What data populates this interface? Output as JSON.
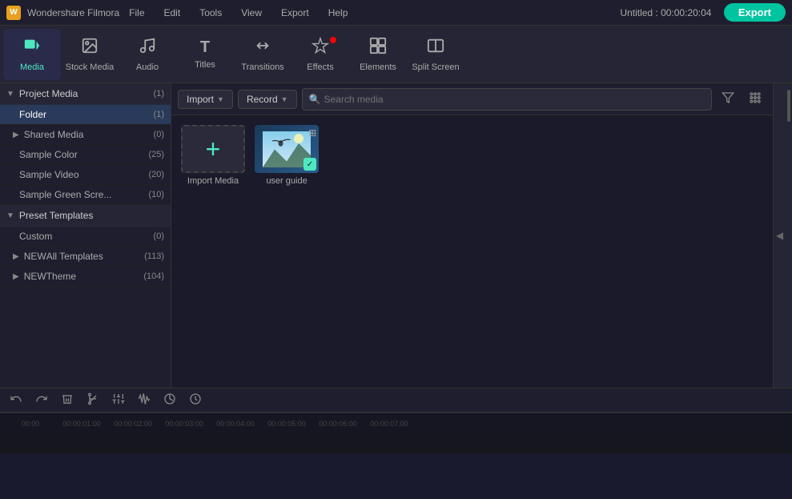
{
  "app": {
    "name": "Wondershare Filmora",
    "logo_letter": "W",
    "title": "Untitled : 00:00:20:04"
  },
  "menu": {
    "items": [
      "File",
      "Edit",
      "Tools",
      "View",
      "Export",
      "Help"
    ]
  },
  "toolbar": {
    "items": [
      {
        "id": "media",
        "label": "Media",
        "icon": "🎬",
        "active": true,
        "badge": false
      },
      {
        "id": "stock-media",
        "label": "Stock Media",
        "icon": "🖼",
        "active": false,
        "badge": false
      },
      {
        "id": "audio",
        "label": "Audio",
        "icon": "🎵",
        "active": false,
        "badge": false
      },
      {
        "id": "titles",
        "label": "Titles",
        "icon": "T",
        "active": false,
        "badge": false
      },
      {
        "id": "transitions",
        "label": "Transitions",
        "icon": "⇄",
        "active": false,
        "badge": false
      },
      {
        "id": "effects",
        "label": "Effects",
        "icon": "✦",
        "active": false,
        "badge": true
      },
      {
        "id": "elements",
        "label": "Elements",
        "icon": "◈",
        "active": false,
        "badge": false
      },
      {
        "id": "split-screen",
        "label": "Split Screen",
        "icon": "⊞",
        "active": false,
        "badge": false
      }
    ],
    "export_label": "Export"
  },
  "sidebar": {
    "project_media_label": "Project Media",
    "project_media_count": "(1)",
    "folder_label": "Folder",
    "folder_count": "(1)",
    "shared_media_label": "Shared Media",
    "shared_media_count": "(0)",
    "sample_color_label": "Sample Color",
    "sample_color_count": "(25)",
    "sample_video_label": "Sample Video",
    "sample_video_count": "(20)",
    "sample_green_label": "Sample Green Scre...",
    "sample_green_count": "(10)",
    "preset_templates_label": "Preset Templates",
    "custom_label": "Custom",
    "custom_count": "(0)",
    "all_templates_label": "All Templates",
    "all_templates_count": "(113)",
    "theme_label": "Theme",
    "theme_count": "(104)"
  },
  "content_toolbar": {
    "import_label": "Import",
    "record_label": "Record",
    "search_placeholder": "Search media"
  },
  "media_items": [
    {
      "id": "import",
      "label": "Import Media",
      "type": "import"
    },
    {
      "id": "user-guide",
      "label": "user guide",
      "type": "video"
    }
  ],
  "timeline": {
    "rulers": [
      "00:00",
      "00:00:01:00",
      "00:00:02:00",
      "00:00:03:00",
      "00:00:04:00",
      "00:00:05:00",
      "00:00:06:00",
      "00:00:07:00"
    ]
  }
}
